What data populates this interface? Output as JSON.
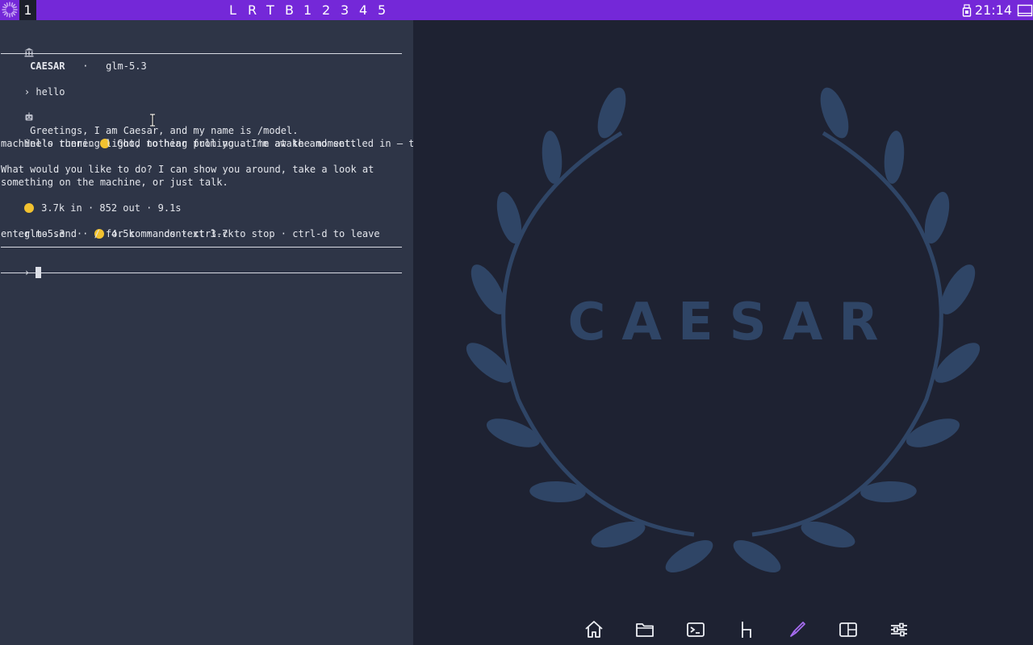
{
  "topbar": {
    "active_workspace": "1",
    "workspaces": [
      "L",
      "R",
      "T",
      "B",
      "1",
      "2",
      "3",
      "4",
      "5"
    ],
    "clock": "21:14"
  },
  "terminal": {
    "header_app": "CAESAR",
    "header_sep": "·",
    "header_model": "glm-5.3",
    "prompt_symbol": "›",
    "user_message": "hello",
    "greeting": "Greetings, I am Caesar, and my name is /model.",
    "reply_line1_a": "Hello there.",
    "reply_line1_b": "Good to hear from you. I'm awake and settled in — the",
    "reply_line2": "machine's running light, nothing pulling at me at the moment.",
    "reply_line3": "What would you like to do? I can show you around, take a look at",
    "reply_line4": "something on the machine, or just talk.",
    "stats": "3.7k in · 852 out · 9.1s",
    "status_model": "glm-5.3",
    "status_tokens": "4.5k",
    "status_context": "context 3.7k",
    "hints": "enter to send · / for commands · ctrl-c to stop · ctrl-d to leave"
  },
  "desktop": {
    "brand": "CAESAR",
    "wreath_color": "#2f4566",
    "dock": [
      {
        "name": "home-icon",
        "active": false
      },
      {
        "name": "folder-icon",
        "active": false
      },
      {
        "name": "terminal-icon",
        "active": false
      },
      {
        "name": "chair-icon",
        "active": false
      },
      {
        "name": "brush-icon",
        "active": true
      },
      {
        "name": "layout-icon",
        "active": false
      },
      {
        "name": "sliders-icon",
        "active": false
      }
    ]
  },
  "colors": {
    "topbar": "#7428d8",
    "terminal_bg": "#2e3547",
    "desktop_bg": "#1e2232",
    "accent": "#a66cf0"
  }
}
